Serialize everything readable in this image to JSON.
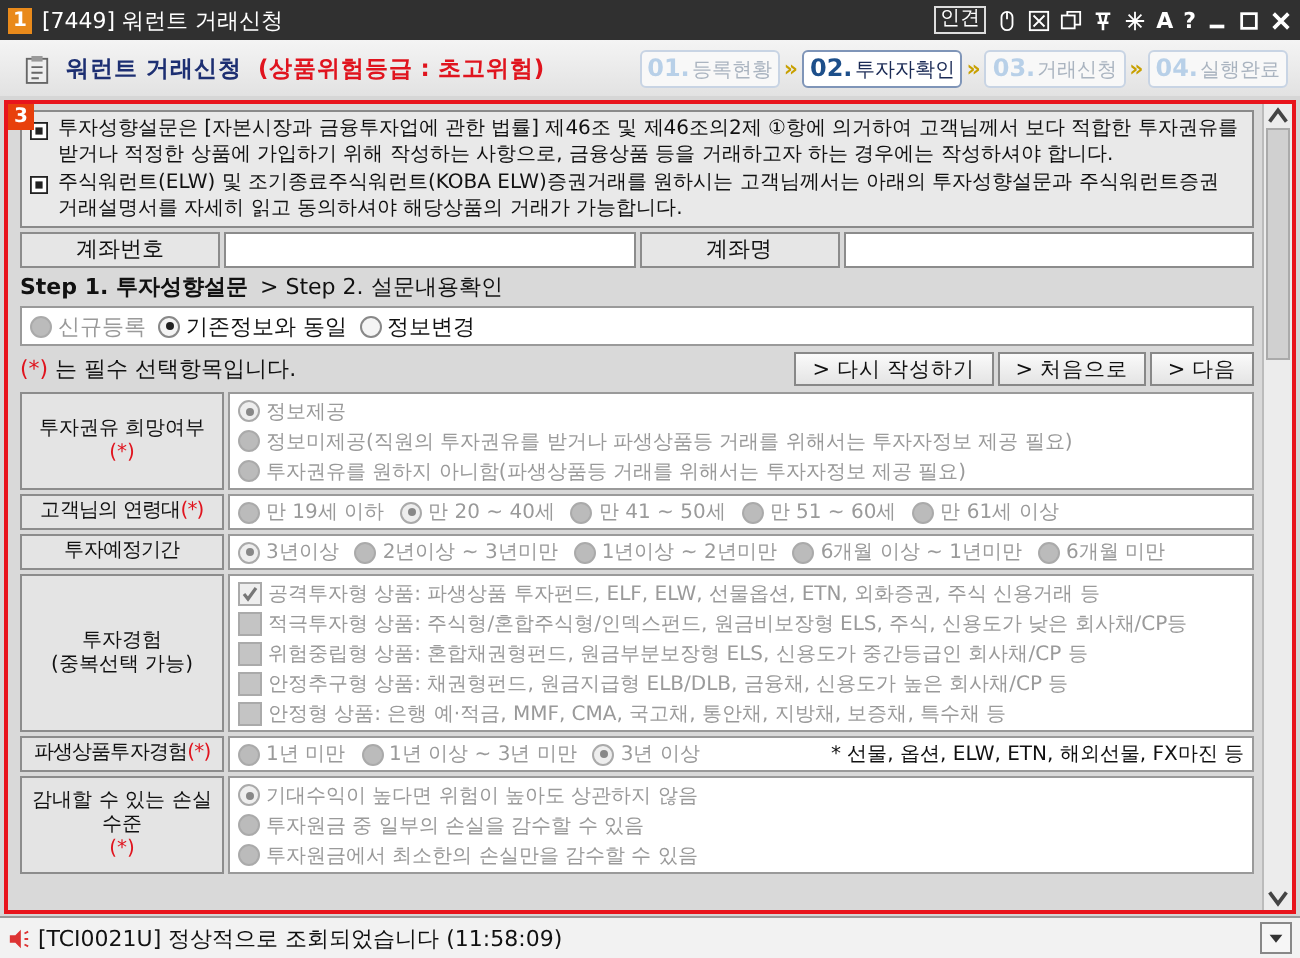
{
  "window": {
    "badge": "1",
    "title": "[7449] 워런트 거래신청",
    "toolbar_label": "인견",
    "toolbar_glyphs": [
      "A",
      "?"
    ]
  },
  "header": {
    "title": "워런트 거래신청",
    "risk": "(상품위험등급 : 초고위험)",
    "separator": "»",
    "steps": [
      {
        "number": "01.",
        "label": "등록현황",
        "selected": false
      },
      {
        "number": "02.",
        "label": "투자자확인",
        "selected": true
      },
      {
        "number": "03.",
        "label": "거래신청",
        "selected": false
      },
      {
        "number": "04.",
        "label": "실행완료",
        "selected": false
      }
    ]
  },
  "panel": {
    "badge": "3",
    "notices": [
      "투자성향설문은 [자본시장과 금융투자업에 관한 법률] 제46조 및 제46조의2제 ①항에 의거하여 고객님께서 보다 적합한 투자권유를 받거나 적정한 상품에 가입하기 위해 작성하는 사항으로, 금융상품 등을 거래하고자 하는 경우에는 작성하셔야 합니다.",
      "주식워런트(ELW) 및 조기종료주식워런트(KOBA ELW)증권거래를 원하시는 고객님께서는 아래의 투자성향설문과 주식워런트증권 거래설명서를 자세히 읽고 동의하셔야 해당상품의 거래가 가능합니다."
    ],
    "account": {
      "number_label": "계좌번호",
      "name_label": "계좌명"
    },
    "step_line": {
      "current": "Step 1. 투자성향설문",
      "next": "> Step 2. 설문내용확인"
    },
    "mode_options": [
      {
        "label": "신규등록",
        "selected": false,
        "disabled": true
      },
      {
        "label": "기존정보와 동일",
        "selected": true,
        "disabled": false
      },
      {
        "label": "정보변경",
        "selected": false,
        "disabled": false
      }
    ],
    "required_note": {
      "mark": "(*)",
      "text": "는 필수 선택항목입니다."
    },
    "buttons": [
      "> 다시 작성하기",
      "> 처음으로",
      "> 다음"
    ],
    "questions": [
      {
        "label": "투자권유 희망여부",
        "mark": "(*)",
        "kind": "radio_list",
        "disabled": true,
        "options": [
          {
            "label": "정보제공",
            "selected": true
          },
          {
            "label": "정보미제공(직원의 투자권유를 받거나 파생상품등 거래를 위해서는 투자자정보 제공 필요)",
            "selected": false
          },
          {
            "label": "투자권유를 원하지 아니함(파생상품등 거래를 위해서는 투자자정보 제공 필요)",
            "selected": false
          }
        ]
      },
      {
        "label": "고객님의 연령대",
        "mark": "(*)",
        "kind": "radio_row",
        "disabled": true,
        "options": [
          {
            "label": "만 19세 이하",
            "selected": false
          },
          {
            "label": "만 20 ~ 40세",
            "selected": true
          },
          {
            "label": "만 41 ~ 50세",
            "selected": false
          },
          {
            "label": "만 51 ~ 60세",
            "selected": false
          },
          {
            "label": "만 61세 이상",
            "selected": false
          }
        ]
      },
      {
        "label": "투자예정기간",
        "kind": "radio_row",
        "disabled": true,
        "options": [
          {
            "label": "3년이상",
            "selected": true
          },
          {
            "label": "2년이상 ~ 3년미만",
            "selected": false
          },
          {
            "label": "1년이상 ~ 2년미만",
            "selected": false
          },
          {
            "label": "6개월 이상 ~ 1년미만",
            "selected": false
          },
          {
            "label": "6개월 미만",
            "selected": false
          }
        ]
      },
      {
        "label": "투자경험",
        "sublabel": "(중복선택 가능)",
        "kind": "checkbox_list",
        "disabled": true,
        "options": [
          {
            "label": "공격투자형 상품: 파생상품 투자펀드, ELF, ELW, 선물옵션, ETN, 외화증권, 주식 신용거래 등",
            "checked": true
          },
          {
            "label": "적극투자형 상품: 주식형/혼합주식형/인덱스펀드, 원금비보장형 ELS, 주식, 신용도가 낮은 회사채/CP등",
            "checked": false
          },
          {
            "label": "위험중립형 상품: 혼합채권형펀드, 원금부분보장형 ELS, 신용도가 중간등급인 회사채/CP 등",
            "checked": false
          },
          {
            "label": "안정추구형 상품: 채권형펀드, 원금지급형 ELB/DLB, 금융채, 신용도가 높은 회사채/CP 등",
            "checked": false
          },
          {
            "label": "안정형 상품: 은행 예·적금, MMF, CMA, 국고채, 통안채, 지방채, 보증채, 특수채 등",
            "checked": false
          }
        ]
      },
      {
        "label": "파생상품투자경험",
        "mark": "(*)",
        "kind": "radio_row",
        "disabled": true,
        "note": "* 선물, 옵션, ELW, ETN, 해외선물, FX마진 등",
        "options": [
          {
            "label": "1년 미만",
            "selected": false
          },
          {
            "label": "1년 이상 ~ 3년 미만",
            "selected": false
          },
          {
            "label": "3년 이상",
            "selected": true
          }
        ]
      },
      {
        "label": "감내할 수 있는 손실 수준",
        "mark": "(*)",
        "kind": "radio_list",
        "disabled": true,
        "options": [
          {
            "label": "기대수익이 높다면 위험이 높아도 상관하지 않음",
            "selected": true
          },
          {
            "label": "투자원금 중 일부의 손실을 감수할 수 있음",
            "selected": false
          },
          {
            "label": "투자원금에서 최소한의 손실만을 감수할 수 있음",
            "selected": false
          }
        ]
      }
    ]
  },
  "status_bar": {
    "message": "[TCI0021U] 정상적으로 조회되었습니다 (11:58:09)"
  }
}
